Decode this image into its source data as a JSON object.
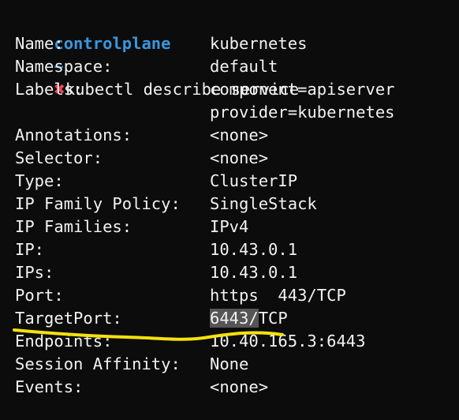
{
  "prompt": {
    "host": "controlplane",
    "tilde": "~",
    "status_icon": "x-mark-icon",
    "status_color": "#e74856",
    "command": "kubectl describe service"
  },
  "rows": [
    {
      "key": "Name:",
      "value": "kubernetes"
    },
    {
      "key": "Namespace:",
      "value": "default"
    },
    {
      "key": "Labels:",
      "value": "component=apiserver"
    },
    {
      "key": "",
      "value": "provider=kubernetes"
    },
    {
      "key": "Annotations:",
      "value": "<none>"
    },
    {
      "key": "Selector:",
      "value": "<none>"
    },
    {
      "key": "Type:",
      "value": "ClusterIP"
    },
    {
      "key": "IP Family Policy:",
      "value": "SingleStack"
    },
    {
      "key": "IP Families:",
      "value": "IPv4"
    },
    {
      "key": "IP:",
      "value": "10.43.0.1"
    },
    {
      "key": "IPs:",
      "value": "10.43.0.1"
    },
    {
      "key": "Port:",
      "value": "https  443/TCP"
    },
    {
      "key": "TargetPort:",
      "value_highlight": "6443/",
      "value_rest": "TCP"
    },
    {
      "key": "Endpoints:",
      "value": "10.40.165.3:6443"
    },
    {
      "key": "Session Affinity:",
      "value": "None"
    },
    {
      "key": "Events:",
      "value": "<none>"
    }
  ],
  "annotation_color": "#f5e10f"
}
